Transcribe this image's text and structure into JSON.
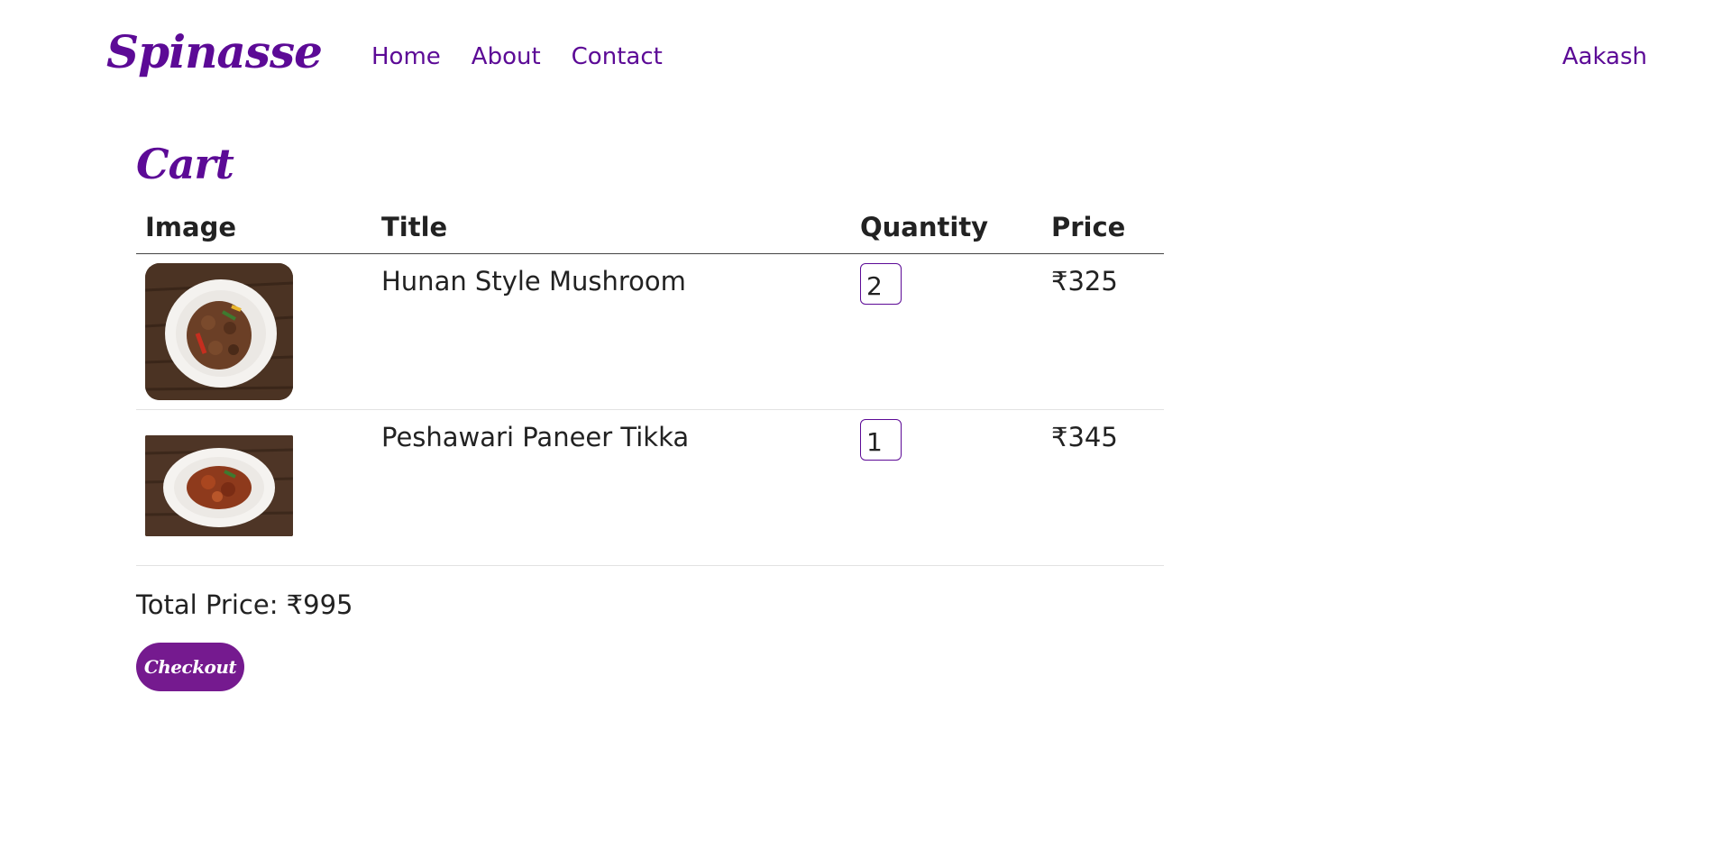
{
  "nav": {
    "brand": "Spinasse",
    "links": [
      "Home",
      "About",
      "Contact"
    ],
    "user": "Aakash"
  },
  "cart": {
    "title": "Cart",
    "headers": [
      "Image",
      "Title",
      "Quantity",
      "Price"
    ],
    "items": [
      {
        "title": "Hunan Style Mushroom",
        "quantity": "2",
        "price": "₹325"
      },
      {
        "title": "Peshawari Paneer Tikka",
        "quantity": "1",
        "price": "₹345"
      }
    ],
    "total": "Total Price: ₹995",
    "checkout_label": "Checkout"
  },
  "colors": {
    "brand": "#5c0a96",
    "button": "#751a8f"
  }
}
